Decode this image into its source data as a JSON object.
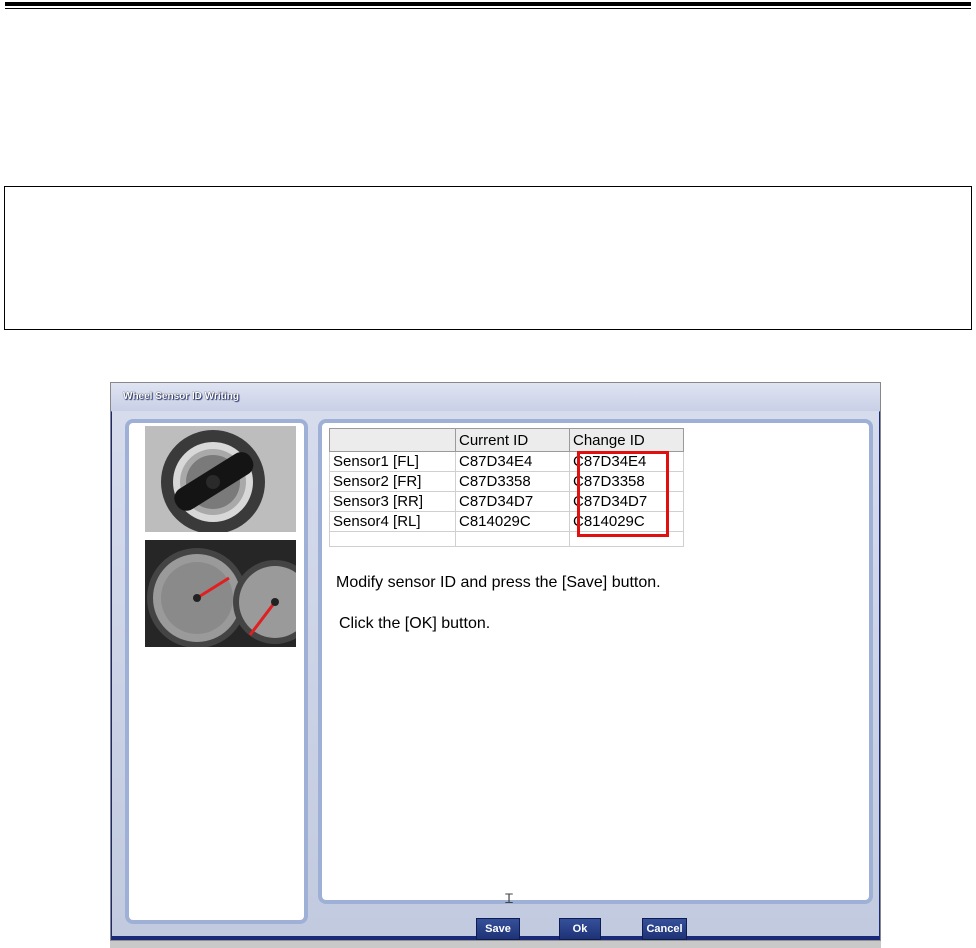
{
  "window": {
    "title": "Wheel Sensor ID Writing"
  },
  "table": {
    "headers": [
      "",
      "Current ID",
      "Change ID"
    ],
    "rows": [
      {
        "sensor": "Sensor1 [FL]",
        "current": "C87D34E4",
        "change": "C87D34E4"
      },
      {
        "sensor": "Sensor2 [FR]",
        "current": "C87D3358",
        "change": "C87D3358"
      },
      {
        "sensor": "Sensor3 [RR]",
        "current": "C87D34D7",
        "change": "C87D34D7"
      },
      {
        "sensor": "Sensor4 [RL]",
        "current": "C814029C",
        "change": "C814029C"
      }
    ]
  },
  "messages": {
    "line1": "Modify sensor ID and press the [Save] button.",
    "line2": "Click the [OK] button."
  },
  "buttons": {
    "save": "Save",
    "ok": "Ok",
    "cancel": "Cancel"
  },
  "colors": {
    "highlight": "#e01010",
    "button": "#1e3276",
    "panel_border": "#9fb0d6"
  }
}
